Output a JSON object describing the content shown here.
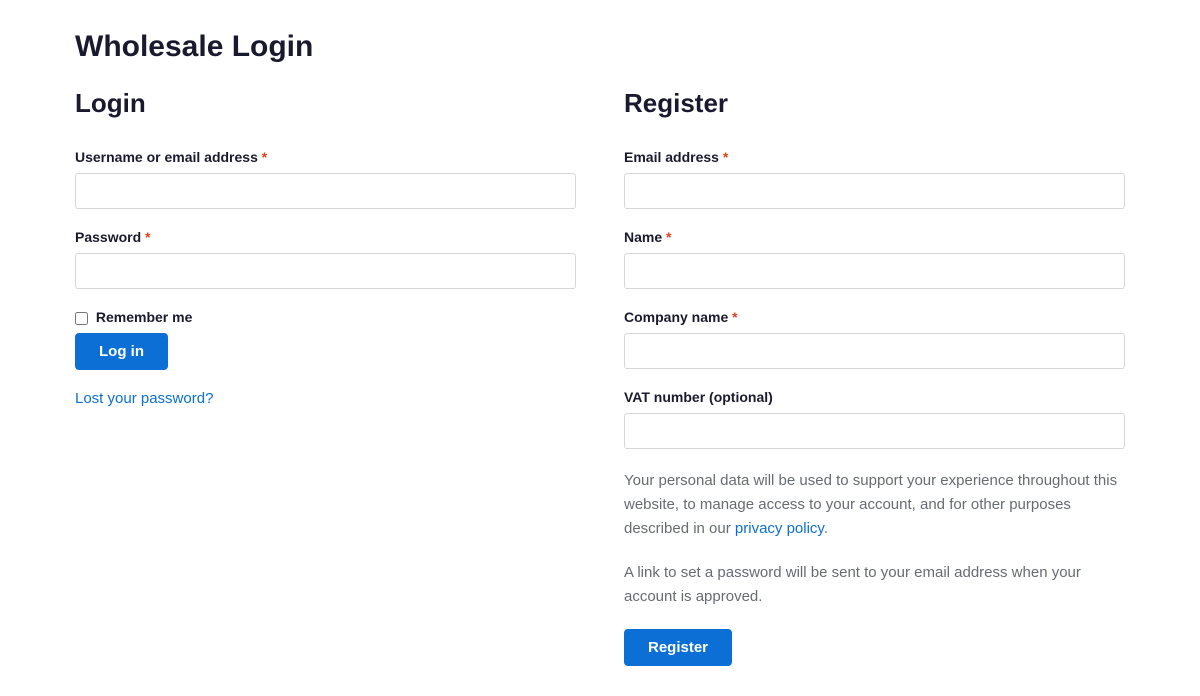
{
  "page": {
    "title": "Wholesale Login"
  },
  "login": {
    "heading": "Login",
    "username_label": "Username or email address ",
    "password_label": "Password ",
    "remember_label": "Remember me",
    "submit_label": "Log in",
    "lost_password_label": "Lost your password?"
  },
  "register": {
    "heading": "Register",
    "email_label": "Email address ",
    "name_label": "Name ",
    "company_label": "Company name ",
    "vat_label": "VAT number (optional)",
    "privacy_text_before": "Your personal data will be used to support your experience throughout this website, to manage access to your account, and for other purposes described in our ",
    "privacy_link_label": "privacy policy",
    "privacy_text_after": ".",
    "password_notice": "A link to set a password will be sent to your email address when your account is approved.",
    "submit_label": "Register"
  },
  "required_marker": "*"
}
